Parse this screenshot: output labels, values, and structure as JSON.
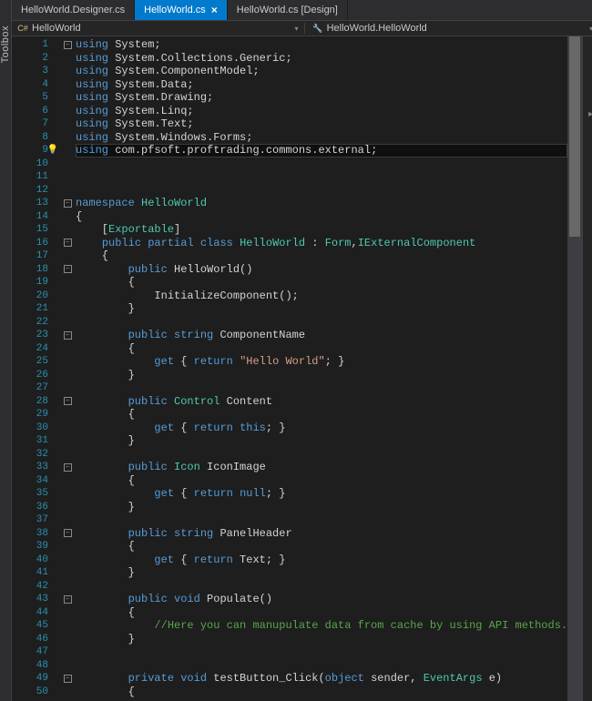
{
  "tabs": [
    {
      "label": "HelloWorld.Designer.cs",
      "active": false,
      "close": ""
    },
    {
      "label": "HelloWorld.cs",
      "active": true,
      "close": "×"
    },
    {
      "label": "HelloWorld.cs [Design]",
      "active": false,
      "close": ""
    }
  ],
  "nav": {
    "left": "HelloWorld",
    "right": "HelloWorld.HelloWorld",
    "icon": "C#",
    "chevron": "▾"
  },
  "toolbox": "Toolbox",
  "bulb": "💡",
  "minus": "−",
  "code": {
    "lines": [
      {
        "n": 1,
        "f": "m",
        "t": [
          [
            "kw",
            "using"
          ],
          [
            "pln",
            " System;"
          ]
        ]
      },
      {
        "n": 2,
        "t": [
          [
            "kw",
            "using"
          ],
          [
            "pln",
            " System.Collections.Generic;"
          ]
        ]
      },
      {
        "n": 3,
        "t": [
          [
            "kw",
            "using"
          ],
          [
            "pln",
            " System.ComponentModel;"
          ]
        ]
      },
      {
        "n": 4,
        "t": [
          [
            "kw",
            "using"
          ],
          [
            "pln",
            " System.Data;"
          ]
        ]
      },
      {
        "n": 5,
        "t": [
          [
            "kw",
            "using"
          ],
          [
            "pln",
            " System.Drawing;"
          ]
        ]
      },
      {
        "n": 6,
        "t": [
          [
            "kw",
            "using"
          ],
          [
            "pln",
            " System.Linq;"
          ]
        ]
      },
      {
        "n": 7,
        "t": [
          [
            "kw",
            "using"
          ],
          [
            "pln",
            " System.Text;"
          ]
        ]
      },
      {
        "n": 8,
        "t": [
          [
            "kw",
            "using"
          ],
          [
            "pln",
            " System.Windows.Forms;"
          ]
        ]
      },
      {
        "n": 9,
        "hl": true,
        "bulb": true,
        "t": [
          [
            "kw",
            "using"
          ],
          [
            "pln",
            " com.pfsoft.proftrading.commons.external;"
          ]
        ]
      },
      {
        "n": 10,
        "t": []
      },
      {
        "n": 11,
        "t": []
      },
      {
        "n": 12,
        "t": []
      },
      {
        "n": 13,
        "f": "m",
        "t": [
          [
            "kw",
            "namespace"
          ],
          [
            "pln",
            " "
          ],
          [
            "typ",
            "HelloWorld"
          ]
        ]
      },
      {
        "n": 14,
        "t": [
          [
            "pln",
            "{"
          ]
        ]
      },
      {
        "n": 15,
        "t": [
          [
            "pln",
            "    ["
          ],
          [
            "typ",
            "Exportable"
          ],
          [
            "pln",
            "]"
          ]
        ]
      },
      {
        "n": 16,
        "f": "m",
        "t": [
          [
            "pln",
            "    "
          ],
          [
            "kw",
            "public"
          ],
          [
            "pln",
            " "
          ],
          [
            "kw",
            "partial"
          ],
          [
            "pln",
            " "
          ],
          [
            "kw",
            "class"
          ],
          [
            "pln",
            " "
          ],
          [
            "typ",
            "HelloWorld"
          ],
          [
            "pln",
            " : "
          ],
          [
            "typ",
            "Form"
          ],
          [
            "pln",
            ","
          ],
          [
            "typ",
            "IExternalComponent"
          ]
        ]
      },
      {
        "n": 17,
        "t": [
          [
            "pln",
            "    {"
          ]
        ]
      },
      {
        "n": 18,
        "f": "m",
        "t": [
          [
            "pln",
            "        "
          ],
          [
            "kw",
            "public"
          ],
          [
            "pln",
            " HelloWorld()"
          ]
        ]
      },
      {
        "n": 19,
        "t": [
          [
            "pln",
            "        {"
          ]
        ]
      },
      {
        "n": 20,
        "t": [
          [
            "pln",
            "            InitializeComponent();"
          ]
        ]
      },
      {
        "n": 21,
        "t": [
          [
            "pln",
            "        }"
          ]
        ]
      },
      {
        "n": 22,
        "t": []
      },
      {
        "n": 23,
        "f": "m",
        "t": [
          [
            "pln",
            "        "
          ],
          [
            "kw",
            "public"
          ],
          [
            "pln",
            " "
          ],
          [
            "kw",
            "string"
          ],
          [
            "pln",
            " ComponentName"
          ]
        ]
      },
      {
        "n": 24,
        "t": [
          [
            "pln",
            "        {"
          ]
        ]
      },
      {
        "n": 25,
        "t": [
          [
            "pln",
            "            "
          ],
          [
            "kw",
            "get"
          ],
          [
            "pln",
            " { "
          ],
          [
            "kw",
            "return"
          ],
          [
            "pln",
            " "
          ],
          [
            "str",
            "\"Hello World\""
          ],
          [
            "pln",
            "; }"
          ]
        ]
      },
      {
        "n": 26,
        "t": [
          [
            "pln",
            "        }"
          ]
        ]
      },
      {
        "n": 27,
        "t": []
      },
      {
        "n": 28,
        "f": "m",
        "t": [
          [
            "pln",
            "        "
          ],
          [
            "kw",
            "public"
          ],
          [
            "pln",
            " "
          ],
          [
            "typ",
            "Control"
          ],
          [
            "pln",
            " Content"
          ]
        ]
      },
      {
        "n": 29,
        "t": [
          [
            "pln",
            "        {"
          ]
        ]
      },
      {
        "n": 30,
        "t": [
          [
            "pln",
            "            "
          ],
          [
            "kw",
            "get"
          ],
          [
            "pln",
            " { "
          ],
          [
            "kw",
            "return"
          ],
          [
            "pln",
            " "
          ],
          [
            "kw",
            "this"
          ],
          [
            "pln",
            "; }"
          ]
        ]
      },
      {
        "n": 31,
        "t": [
          [
            "pln",
            "        }"
          ]
        ]
      },
      {
        "n": 32,
        "t": []
      },
      {
        "n": 33,
        "f": "m",
        "t": [
          [
            "pln",
            "        "
          ],
          [
            "kw",
            "public"
          ],
          [
            "pln",
            " "
          ],
          [
            "typ",
            "Icon"
          ],
          [
            "pln",
            " IconImage"
          ]
        ]
      },
      {
        "n": 34,
        "t": [
          [
            "pln",
            "        {"
          ]
        ]
      },
      {
        "n": 35,
        "t": [
          [
            "pln",
            "            "
          ],
          [
            "kw",
            "get"
          ],
          [
            "pln",
            " { "
          ],
          [
            "kw",
            "return"
          ],
          [
            "pln",
            " "
          ],
          [
            "kw",
            "null"
          ],
          [
            "pln",
            "; }"
          ]
        ]
      },
      {
        "n": 36,
        "t": [
          [
            "pln",
            "        }"
          ]
        ]
      },
      {
        "n": 37,
        "t": []
      },
      {
        "n": 38,
        "f": "m",
        "t": [
          [
            "pln",
            "        "
          ],
          [
            "kw",
            "public"
          ],
          [
            "pln",
            " "
          ],
          [
            "kw",
            "string"
          ],
          [
            "pln",
            " PanelHeader"
          ]
        ]
      },
      {
        "n": 39,
        "t": [
          [
            "pln",
            "        {"
          ]
        ]
      },
      {
        "n": 40,
        "t": [
          [
            "pln",
            "            "
          ],
          [
            "kw",
            "get"
          ],
          [
            "pln",
            " { "
          ],
          [
            "kw",
            "return"
          ],
          [
            "pln",
            " Text; }"
          ]
        ]
      },
      {
        "n": 41,
        "t": [
          [
            "pln",
            "        }"
          ]
        ]
      },
      {
        "n": 42,
        "t": []
      },
      {
        "n": 43,
        "f": "m",
        "t": [
          [
            "pln",
            "        "
          ],
          [
            "kw",
            "public"
          ],
          [
            "pln",
            " "
          ],
          [
            "kw",
            "void"
          ],
          [
            "pln",
            " Populate()"
          ]
        ]
      },
      {
        "n": 44,
        "t": [
          [
            "pln",
            "        {"
          ]
        ]
      },
      {
        "n": 45,
        "t": [
          [
            "pln",
            "            "
          ],
          [
            "cmt",
            "//Here you can manupulate data from cache by using API methods."
          ]
        ]
      },
      {
        "n": 46,
        "t": [
          [
            "pln",
            "        }"
          ]
        ]
      },
      {
        "n": 47,
        "t": []
      },
      {
        "n": 48,
        "t": []
      },
      {
        "n": 49,
        "f": "m",
        "t": [
          [
            "pln",
            "        "
          ],
          [
            "kw",
            "private"
          ],
          [
            "pln",
            " "
          ],
          [
            "kw",
            "void"
          ],
          [
            "pln",
            " testButton_Click("
          ],
          [
            "kw",
            "object"
          ],
          [
            "pln",
            " sender, "
          ],
          [
            "typ",
            "EventArgs"
          ],
          [
            "pln",
            " e)"
          ]
        ]
      },
      {
        "n": 50,
        "t": [
          [
            "pln",
            "        {"
          ]
        ]
      }
    ]
  }
}
